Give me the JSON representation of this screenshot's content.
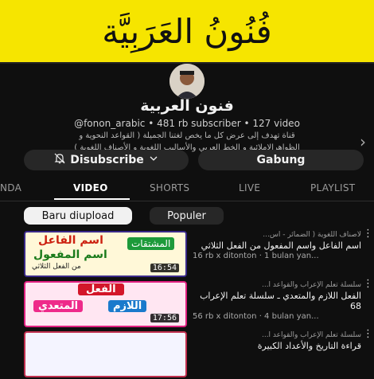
{
  "banner": {
    "text": "فُنُونُ العَرَبِيَّة"
  },
  "channel": {
    "name": "فنون العربية",
    "meta": "@fonon_arabic • 481 rb subscriber • 127 video",
    "description_line1": "قناة تهدف إلى عرض كل ما يخص لغتنا الجميلة ( القواعد النحوية و",
    "description_line2": "الظواهرالإملائية و الخط العربي والأساليب اللغوية و الأصناف اللغوية )"
  },
  "buttons": {
    "unsubscribe": "Disubscribe",
    "join": "Gabung"
  },
  "tabs": [
    "NDA",
    "VIDEO",
    "SHORTS",
    "LIVE",
    "PLAYLIST"
  ],
  "chips": [
    "Baru diupload",
    "Populer"
  ],
  "videos": [
    {
      "thumb_line1": "اسم الفاعل",
      "thumb_line2": "اسم المفعول",
      "thumb_badge": "المشتقات",
      "thumb_line3": "من الفعل الثلاثي",
      "duration": "16:54",
      "playlist": "لأصناف اللغوية ( الضمائر - أس...",
      "title": "اسم الفاعل واسم المفعول من الفعل الثلاثي",
      "stats": "16 rb x ditonton · 1 bulan yan..."
    },
    {
      "thumb_line1": "الفعل",
      "thumb_line2": "اللازم",
      "thumb_line3": "المتعدي",
      "duration": "17:56",
      "playlist": "سلسلة تعلم الإعراب والقواعد ا...",
      "title": "الفعل اللازم والمتعدي ـ سلسلة تعلم الإعراب 68",
      "stats": "56 rb x ditonton · 4 bulan yan..."
    },
    {
      "playlist": "سلسلة تعلم الإعراب والقواعد ا...",
      "title": "قراءة التاريخ والأعداد الكبيرة"
    }
  ],
  "colors": {
    "banner": "#f6e500",
    "background": "#0f0f0f",
    "chip_selected": "#f1f1f1"
  }
}
